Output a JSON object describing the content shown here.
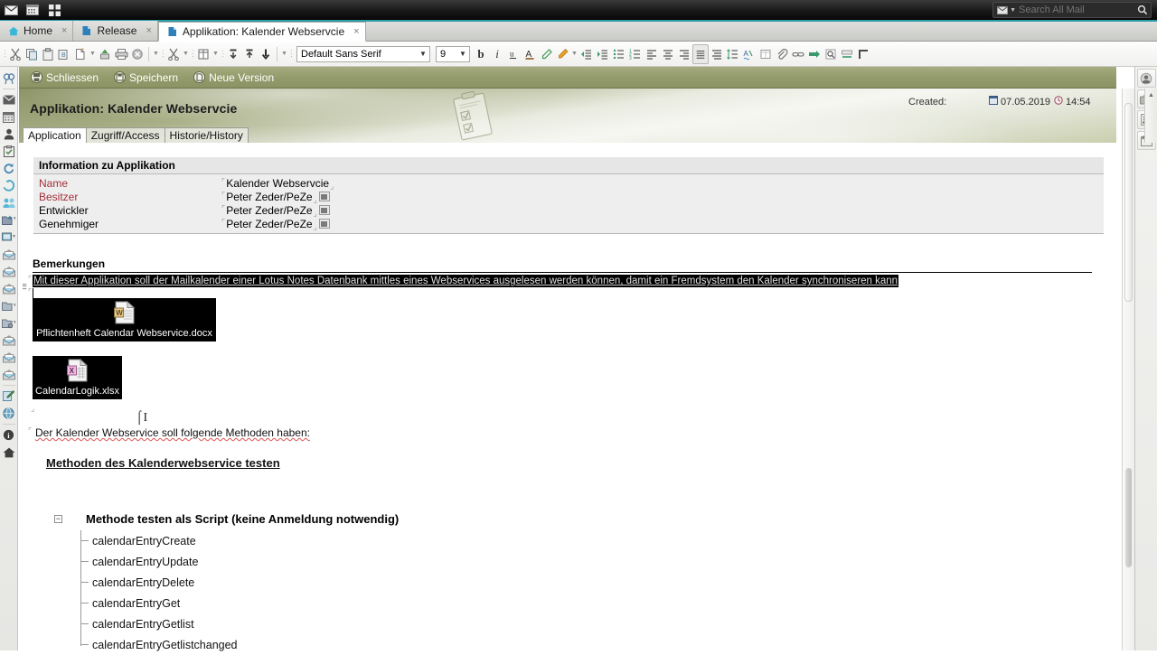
{
  "topbar": {
    "icons": [
      "mail-icon",
      "calendar-icon",
      "apps-icon"
    ],
    "search": {
      "placeholder": "Search All Mail",
      "value": "",
      "scope_icon": "mail-scope-icon",
      "button_icon": "search-icon"
    }
  },
  "tabs": [
    {
      "label": "Home",
      "icon": "home-icon",
      "close": "×",
      "active": false
    },
    {
      "label": "Release",
      "icon": "document-icon",
      "close": "×",
      "active": false
    },
    {
      "label": "Applikation: Kalender Webservcie",
      "icon": "document-icon",
      "close": "×",
      "active": true
    }
  ],
  "format_toolbar": {
    "font_family": "Default Sans Serif",
    "font_size": "9",
    "buttons": [
      "cut-icon",
      "copy-icon",
      "paste-icon",
      "paste-special-icon",
      "new-doc-icon",
      "export-icon",
      "print-icon",
      "delete-icon",
      "cut2-icon",
      "table-icon",
      "indent-down-icon",
      "indent-up-icon",
      "move-down-icon",
      "bold-icon",
      "italic-icon",
      "underline-icon",
      "font-color-icon",
      "highlight-icon",
      "text-color-icon",
      "outdent-icon",
      "indent-icon",
      "bullet-list-icon",
      "number-list-icon",
      "align-left-icon",
      "align-center-icon",
      "align-right-icon",
      "justify-icon",
      "align-full-icon",
      "line-spacing-icon",
      "spell-check-icon",
      "table-insert-icon",
      "attach-icon",
      "link-icon",
      "anchor-icon",
      "find-icon",
      "section-icon",
      "paragraph-icon"
    ],
    "bold_label": "b",
    "italic_label": "i",
    "underline_label": "u"
  },
  "left_rail": [
    "search-icon",
    "mail-icon",
    "calendar-icon",
    "contacts-icon",
    "todo-icon",
    "replication-icon",
    "feeds-icon",
    "community-icon",
    "favorites-icon",
    "screen-icon",
    "inbox-icon",
    "inbox2-icon",
    "inbox3-icon",
    "folder-icon",
    "folder-settings-icon",
    "mail-open-icon",
    "mail-open2-icon",
    "mail-open3-icon",
    "compose-icon",
    "web-icon",
    "info-icon",
    "home-icon"
  ],
  "right_rail": [
    "presence-icon",
    "business-card-icon",
    "feed-icon",
    "calendar-widget-icon"
  ],
  "action_bar": [
    {
      "label": "Schliessen",
      "icon": "close-doc-icon"
    },
    {
      "label": "Speichern",
      "icon": "save-icon"
    },
    {
      "label": "Neue Version",
      "icon": "new-version-icon"
    }
  ],
  "document": {
    "title": "Applikation: Kalender Webservcie",
    "created_label": "Created:",
    "created_date": "07.05.2019",
    "created_time": "14:54",
    "date_icon": "date-icon",
    "time_icon": "clock-icon",
    "banner_image": "clipboard-illustration",
    "tabs": [
      {
        "label": "Application",
        "active": true
      },
      {
        "label": "Zugriff/Access",
        "active": false
      },
      {
        "label": "Historie/History",
        "active": false
      }
    ]
  },
  "info_section": {
    "header": "Information zu Applikation",
    "rows": [
      {
        "label": "Name",
        "value": "Kalender Webservcie",
        "required": true,
        "picker": false
      },
      {
        "label": "Besitzer",
        "value": "Peter Zeder/PeZe",
        "required": true,
        "picker": true
      },
      {
        "label": "Entwickler",
        "value": "Peter Zeder/PeZe",
        "required": false,
        "picker": true
      },
      {
        "label": "Genehmiger",
        "value": "Peter Zeder/PeZe",
        "required": false,
        "picker": true
      }
    ]
  },
  "remarks": {
    "header": "Bemerkungen",
    "selected_text": "Mit dieser Applikation soll der Mailkalender einer Lotus Notes Datenbank mittles eines Webservices ausgelesen werden können, damit ein Fremdsystem den Kalender synchroniseren kann",
    "attachments": [
      {
        "filename": "Pflichtenheft Calendar Webservice.docx",
        "icon": "word-document-icon"
      },
      {
        "filename": "CalendarLogik.xlsx",
        "icon": "excel-spreadsheet-icon"
      }
    ],
    "intro_line": "Der Kalender Webservice soll folgende Methoden haben:",
    "section_heading": "Methoden des Kalenderwebservice testen"
  },
  "method_tree": {
    "toggle": "−",
    "heading": "Methode testen als Script (keine Anmeldung notwendig)",
    "items": [
      "calendarEntryCreate",
      "calendarEntryUpdate",
      "calendarEntryDelete",
      "calendarEntryGet",
      "calendarEntryGetlist",
      "calendarEntryGetlistchanged"
    ]
  },
  "colors": {
    "accent_teal": "#2f9ba6",
    "action_olive": "#949b6c",
    "required_red": "#a4303a",
    "selection_black": "#000000",
    "spellcheck_red": "#e05252"
  }
}
